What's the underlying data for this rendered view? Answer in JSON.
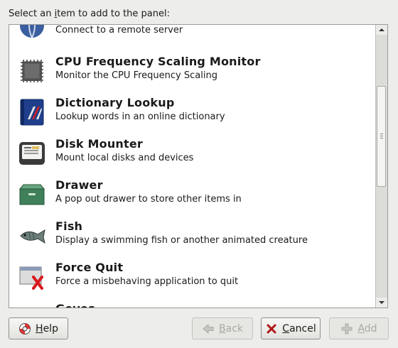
{
  "dialog": {
    "prompt_prefix": "Select an ",
    "prompt_underlined": "i",
    "prompt_suffix": "tem to add to the panel:"
  },
  "items": [
    {
      "name": "",
      "desc": "Connect to a remote server",
      "icon": "globe-icon"
    },
    {
      "name": "CPU Frequency Scaling Monitor",
      "desc": "Monitor the CPU Frequency Scaling",
      "icon": "cpu-chip-icon"
    },
    {
      "name": "Dictionary Lookup",
      "desc": "Lookup words in an online dictionary",
      "icon": "dictionary-book-icon"
    },
    {
      "name": "Disk Mounter",
      "desc": "Mount local disks and devices",
      "icon": "disk-drive-icon"
    },
    {
      "name": "Drawer",
      "desc": "A pop out drawer to store other items in",
      "icon": "drawer-icon"
    },
    {
      "name": "Fish",
      "desc": "Display a swimming fish or another animated creature",
      "icon": "fish-icon"
    },
    {
      "name": "Force Quit",
      "desc": "Force a misbehaving application to quit",
      "icon": "force-quit-icon"
    },
    {
      "name": "Geyes",
      "desc": "",
      "icon": "eyes-icon"
    }
  ],
  "buttons": {
    "help": {
      "label_u": "H",
      "label_rest": "elp"
    },
    "back": {
      "label_u": "B",
      "label_rest": "ack"
    },
    "cancel": {
      "label_u": "C",
      "label_rest": "ancel"
    },
    "add": {
      "label_u": "A",
      "label_rest": "dd"
    }
  }
}
